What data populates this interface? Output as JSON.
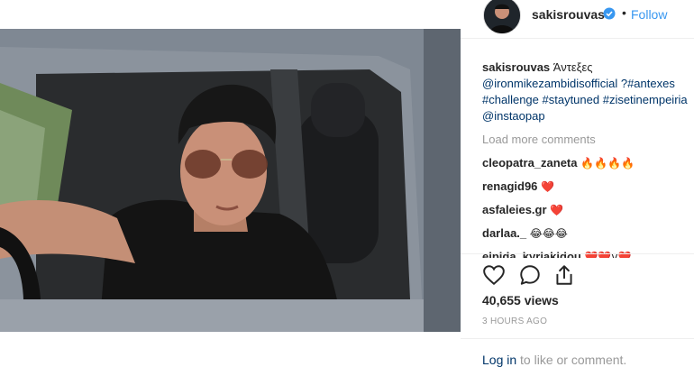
{
  "header": {
    "username": "sakisrouvas",
    "follow_label": "Follow",
    "dot": "•"
  },
  "caption": {
    "username": "sakisrouvas",
    "text": "Άντεξες",
    "line2": "@ironmikezambidisofficial ?#antexes",
    "line3": "#challenge #staytuned #zisetinempeiria",
    "line4": "@instaopap"
  },
  "load_more": "Load more comments",
  "comments": [
    {
      "user": "cleopatra_zaneta",
      "emoji": "🔥🔥🔥🔥"
    },
    {
      "user": "renagid96",
      "emoji": "❤️"
    },
    {
      "user": "asfaleies.gr",
      "emoji": "❤️"
    },
    {
      "user": "darlaa._",
      "emoji": "😂😂😂"
    },
    {
      "user": "elpida_kyriakidou",
      "emoji": "❤️❤️v❤️"
    }
  ],
  "stats": {
    "views": "40,655 views",
    "time_ago": "3 HOURS AGO"
  },
  "login": {
    "link": "Log in",
    "rest": " to like or comment."
  },
  "colors": {
    "accent": "#3897f0",
    "link": "#003569",
    "muted": "#999999"
  }
}
